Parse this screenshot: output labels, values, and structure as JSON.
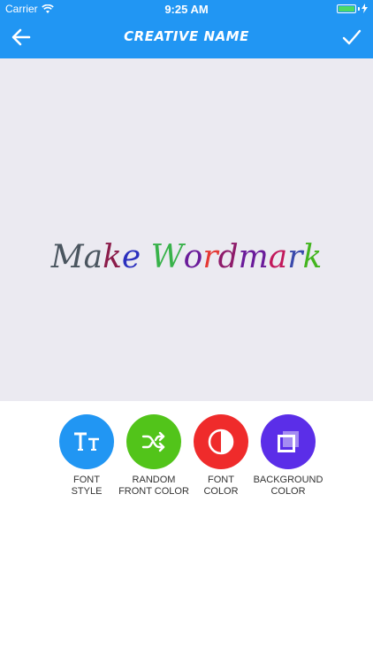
{
  "status": {
    "carrier": "Carrier",
    "time": "9:25 AM"
  },
  "header": {
    "title": "CREATIVE NAME",
    "back_icon": "back-arrow-icon",
    "confirm_icon": "checkmark-icon"
  },
  "canvas": {
    "background": "#ebeaf1",
    "wordmark": {
      "text": "Make Wordmark",
      "letters": [
        {
          "ch": "M",
          "color": "#4a555f"
        },
        {
          "ch": "a",
          "color": "#4a555f"
        },
        {
          "ch": "k",
          "color": "#8b1c4a"
        },
        {
          "ch": "e",
          "color": "#2a2fbe"
        },
        {
          "ch": " ",
          "color": "#000000"
        },
        {
          "ch": "W",
          "color": "#38b24a"
        },
        {
          "ch": "o",
          "color": "#6a1b9a"
        },
        {
          "ch": "r",
          "color": "#e53935"
        },
        {
          "ch": "d",
          "color": "#8e1b6a"
        },
        {
          "ch": "m",
          "color": "#6a1b9a"
        },
        {
          "ch": "a",
          "color": "#c2185b"
        },
        {
          "ch": "r",
          "color": "#3949ab"
        },
        {
          "ch": "k",
          "color": "#43b51f"
        }
      ]
    }
  },
  "tools": [
    {
      "label": "FONT\nSTYLE",
      "color": "#2196f3",
      "icon": "font-style-icon"
    },
    {
      "label": "RANDOM\nFRONT COLOR",
      "color": "#52c41a",
      "icon": "shuffle-icon"
    },
    {
      "label": "FONT\nCOLOR",
      "color": "#ef2b2b",
      "icon": "contrast-icon"
    },
    {
      "label": "BACKGROUND\nCOLOR",
      "color": "#5b2ee8",
      "icon": "layers-icon"
    }
  ]
}
